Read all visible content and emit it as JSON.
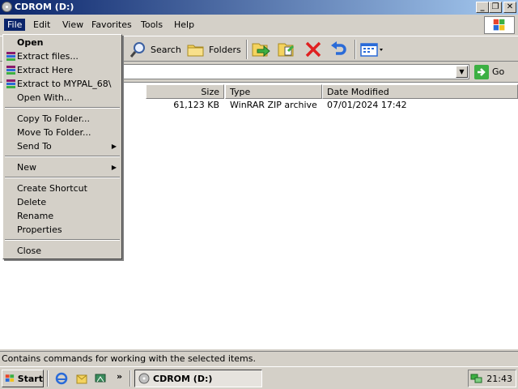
{
  "window": {
    "title": "CDROM (D:)"
  },
  "menubar": {
    "items": [
      "File",
      "Edit",
      "View",
      "Favorites",
      "Tools",
      "Help"
    ]
  },
  "toolbar": {
    "search_label": "Search",
    "folders_label": "Folders"
  },
  "addressbar": {
    "value": "",
    "go_label": "Go"
  },
  "file_menu": {
    "items": [
      "Open",
      "Extract files...",
      "Extract Here",
      "Extract to MYPAL_68\\",
      "Open With...",
      "Copy To Folder...",
      "Move To Folder...",
      "Send To",
      "New",
      "Create Shortcut",
      "Delete",
      "Rename",
      "Properties",
      "Close"
    ]
  },
  "list": {
    "columns": [
      "Size",
      "Type",
      "Date Modified"
    ],
    "rows": [
      {
        "size": "61,123 KB",
        "type": "WinRAR ZIP archive",
        "modified": "07/01/2024 17:42"
      }
    ]
  },
  "statusbar": {
    "text": "Contains commands for working with the selected items."
  },
  "taskbar": {
    "start_label": "Start",
    "window_button": "CDROM (D:)",
    "chevron": "»",
    "clock": "21:43"
  }
}
